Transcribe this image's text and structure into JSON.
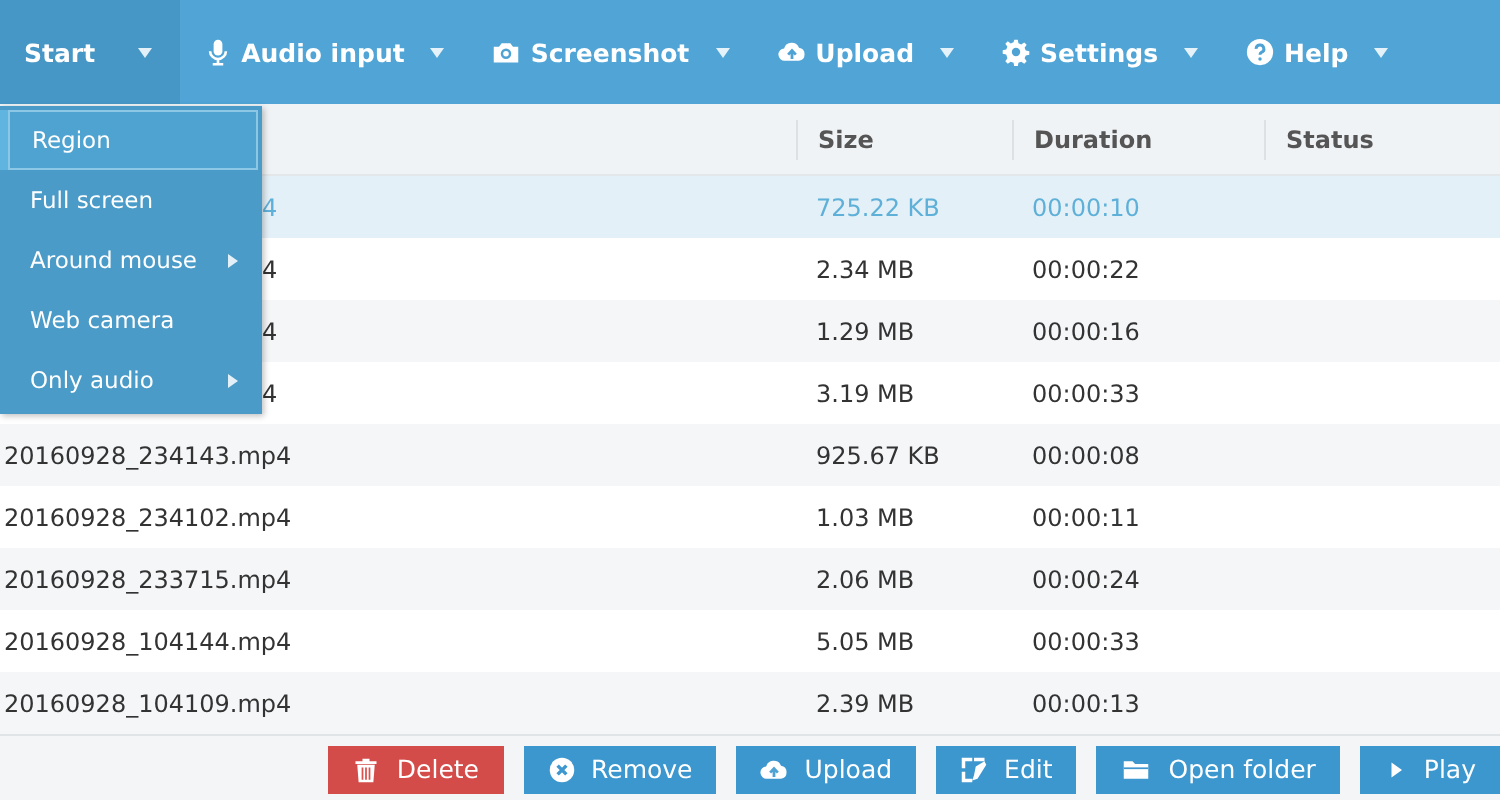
{
  "toolbar": [
    {
      "label": "Start",
      "active": true
    },
    {
      "label": "Audio input",
      "active": false
    },
    {
      "label": "Screenshot",
      "active": false
    },
    {
      "label": "Upload",
      "active": false
    },
    {
      "label": "Settings",
      "active": false
    },
    {
      "label": "Help",
      "active": false
    }
  ],
  "start_menu": [
    {
      "label": "Region",
      "selected": true,
      "submenu": false
    },
    {
      "label": "Full screen",
      "selected": false,
      "submenu": false
    },
    {
      "label": "Around mouse",
      "selected": false,
      "submenu": true
    },
    {
      "label": "Web camera",
      "selected": false,
      "submenu": false
    },
    {
      "label": "Only audio",
      "selected": false,
      "submenu": true
    }
  ],
  "table": {
    "columns": [
      "Size",
      "Duration",
      "Status"
    ],
    "rows": [
      {
        "name_tail": "4",
        "size": "725.22 KB",
        "duration": "00:00:10",
        "selected": true
      },
      {
        "name_tail": "4",
        "size": "2.34 MB",
        "duration": "00:00:22",
        "selected": false
      },
      {
        "name_tail": "4",
        "size": "1.29 MB",
        "duration": "00:00:16",
        "selected": false
      },
      {
        "name_tail": "4",
        "size": "3.19 MB",
        "duration": "00:00:33",
        "selected": false
      },
      {
        "name": "20160928_234143.mp4",
        "size": "925.67 KB",
        "duration": "00:00:08",
        "selected": false
      },
      {
        "name": "20160928_234102.mp4",
        "size": "1.03 MB",
        "duration": "00:00:11",
        "selected": false
      },
      {
        "name": "20160928_233715.mp4",
        "size": "2.06 MB",
        "duration": "00:00:24",
        "selected": false
      },
      {
        "name": "20160928_104144.mp4",
        "size": "5.05 MB",
        "duration": "00:00:33",
        "selected": false
      },
      {
        "name": "20160928_104109.mp4",
        "size": "2.39 MB",
        "duration": "00:00:13",
        "selected": false
      }
    ]
  },
  "buttons": [
    {
      "label": "Delete",
      "kind": "danger"
    },
    {
      "label": "Remove",
      "kind": "primary"
    },
    {
      "label": "Upload",
      "kind": "primary"
    },
    {
      "label": "Edit",
      "kind": "primary"
    },
    {
      "label": "Open folder",
      "kind": "primary"
    },
    {
      "label": "Play",
      "kind": "primary"
    }
  ]
}
